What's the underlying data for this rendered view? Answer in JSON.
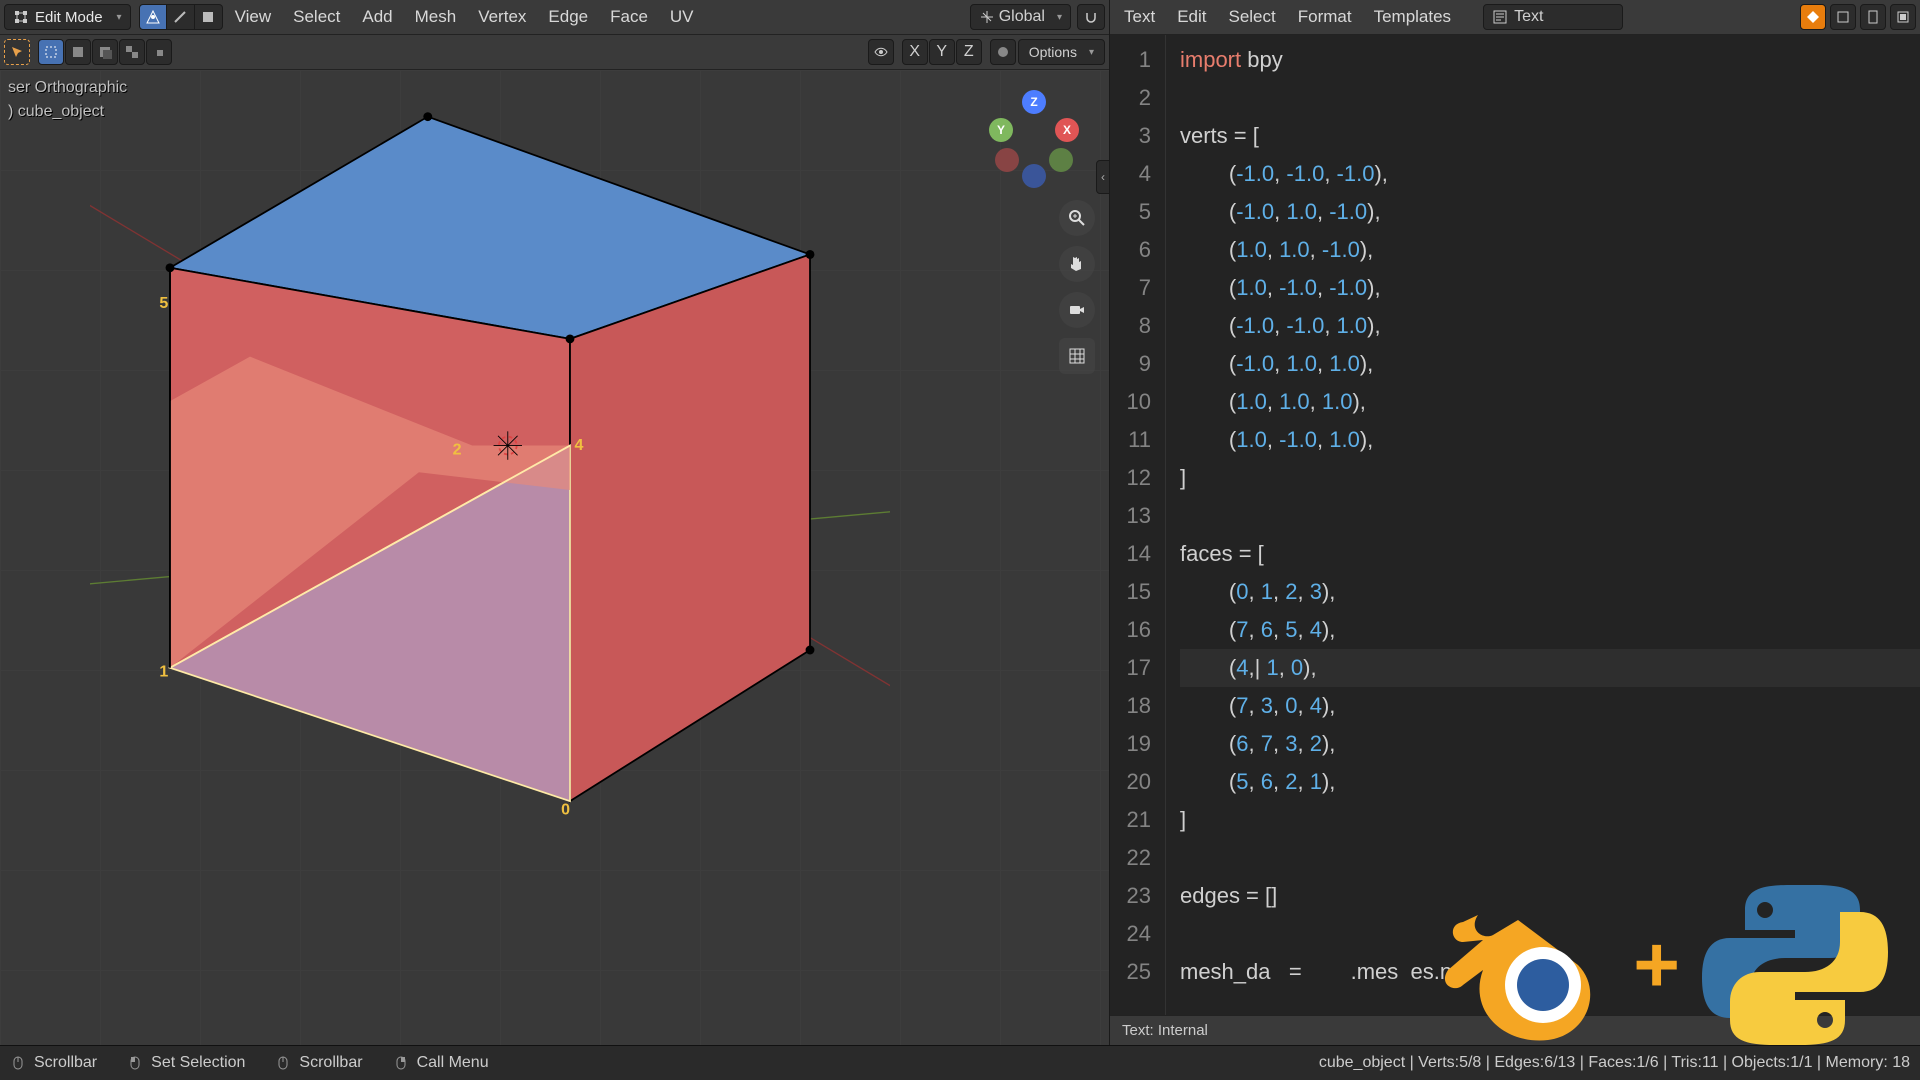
{
  "viewport": {
    "mode": "Edit Mode",
    "menus": [
      "View",
      "Select",
      "Add",
      "Mesh",
      "Vertex",
      "Edge",
      "Face",
      "UV"
    ],
    "orientation": "Global",
    "options_label": "Options",
    "axes": [
      "X",
      "Y",
      "Z"
    ],
    "overlay_view": "ser Orthographic",
    "overlay_object": ") cube_object",
    "gizmo": {
      "x": "X",
      "y": "Y",
      "z": "Z"
    },
    "vertex_labels": [
      "5",
      "2",
      "4",
      "1",
      "0"
    ]
  },
  "text_editor": {
    "menus": [
      "Text",
      "Edit",
      "Select",
      "Format",
      "Templates"
    ],
    "name": "Text",
    "footer": "Text: Internal",
    "code_lines": [
      {
        "n": 1,
        "tokens": [
          {
            "t": "import",
            "c": "kw"
          },
          {
            "t": " bpy",
            "c": "ident"
          }
        ]
      },
      {
        "n": 2,
        "tokens": []
      },
      {
        "n": 3,
        "tokens": [
          {
            "t": "verts = [",
            "c": "ident"
          }
        ]
      },
      {
        "n": 4,
        "tokens": [
          {
            "t": "        (",
            "c": "ident"
          },
          {
            "t": "-1.0",
            "c": "num"
          },
          {
            "t": ", ",
            "c": "ident"
          },
          {
            "t": "-1.0",
            "c": "num"
          },
          {
            "t": ", ",
            "c": "ident"
          },
          {
            "t": "-1.0",
            "c": "num"
          },
          {
            "t": "),",
            "c": "ident"
          }
        ]
      },
      {
        "n": 5,
        "tokens": [
          {
            "t": "        (",
            "c": "ident"
          },
          {
            "t": "-1.0",
            "c": "num"
          },
          {
            "t": ", ",
            "c": "ident"
          },
          {
            "t": "1.0",
            "c": "num"
          },
          {
            "t": ", ",
            "c": "ident"
          },
          {
            "t": "-1.0",
            "c": "num"
          },
          {
            "t": "),",
            "c": "ident"
          }
        ]
      },
      {
        "n": 6,
        "tokens": [
          {
            "t": "        (",
            "c": "ident"
          },
          {
            "t": "1.0",
            "c": "num"
          },
          {
            "t": ", ",
            "c": "ident"
          },
          {
            "t": "1.0",
            "c": "num"
          },
          {
            "t": ", ",
            "c": "ident"
          },
          {
            "t": "-1.0",
            "c": "num"
          },
          {
            "t": "),",
            "c": "ident"
          }
        ]
      },
      {
        "n": 7,
        "tokens": [
          {
            "t": "        (",
            "c": "ident"
          },
          {
            "t": "1.0",
            "c": "num"
          },
          {
            "t": ", ",
            "c": "ident"
          },
          {
            "t": "-1.0",
            "c": "num"
          },
          {
            "t": ", ",
            "c": "ident"
          },
          {
            "t": "-1.0",
            "c": "num"
          },
          {
            "t": "),",
            "c": "ident"
          }
        ]
      },
      {
        "n": 8,
        "tokens": [
          {
            "t": "        (",
            "c": "ident"
          },
          {
            "t": "-1.0",
            "c": "num"
          },
          {
            "t": ", ",
            "c": "ident"
          },
          {
            "t": "-1.0",
            "c": "num"
          },
          {
            "t": ", ",
            "c": "ident"
          },
          {
            "t": "1.0",
            "c": "num"
          },
          {
            "t": "),",
            "c": "ident"
          }
        ]
      },
      {
        "n": 9,
        "tokens": [
          {
            "t": "        (",
            "c": "ident"
          },
          {
            "t": "-1.0",
            "c": "num"
          },
          {
            "t": ", ",
            "c": "ident"
          },
          {
            "t": "1.0",
            "c": "num"
          },
          {
            "t": ", ",
            "c": "ident"
          },
          {
            "t": "1.0",
            "c": "num"
          },
          {
            "t": "),",
            "c": "ident"
          }
        ]
      },
      {
        "n": 10,
        "tokens": [
          {
            "t": "        (",
            "c": "ident"
          },
          {
            "t": "1.0",
            "c": "num"
          },
          {
            "t": ", ",
            "c": "ident"
          },
          {
            "t": "1.0",
            "c": "num"
          },
          {
            "t": ", ",
            "c": "ident"
          },
          {
            "t": "1.0",
            "c": "num"
          },
          {
            "t": "),",
            "c": "ident"
          }
        ]
      },
      {
        "n": 11,
        "tokens": [
          {
            "t": "        (",
            "c": "ident"
          },
          {
            "t": "1.0",
            "c": "num"
          },
          {
            "t": ", ",
            "c": "ident"
          },
          {
            "t": "-1.0",
            "c": "num"
          },
          {
            "t": ", ",
            "c": "ident"
          },
          {
            "t": "1.0",
            "c": "num"
          },
          {
            "t": "),",
            "c": "ident"
          }
        ]
      },
      {
        "n": 12,
        "tokens": [
          {
            "t": "]",
            "c": "ident"
          }
        ]
      },
      {
        "n": 13,
        "tokens": []
      },
      {
        "n": 14,
        "tokens": [
          {
            "t": "faces = [",
            "c": "ident"
          }
        ]
      },
      {
        "n": 15,
        "tokens": [
          {
            "t": "        (",
            "c": "ident"
          },
          {
            "t": "0",
            "c": "num"
          },
          {
            "t": ", ",
            "c": "ident"
          },
          {
            "t": "1",
            "c": "num"
          },
          {
            "t": ", ",
            "c": "ident"
          },
          {
            "t": "2",
            "c": "num"
          },
          {
            "t": ", ",
            "c": "ident"
          },
          {
            "t": "3",
            "c": "num"
          },
          {
            "t": "),",
            "c": "ident"
          }
        ]
      },
      {
        "n": 16,
        "tokens": [
          {
            "t": "        (",
            "c": "ident"
          },
          {
            "t": "7",
            "c": "num"
          },
          {
            "t": ", ",
            "c": "ident"
          },
          {
            "t": "6",
            "c": "num"
          },
          {
            "t": ", ",
            "c": "ident"
          },
          {
            "t": "5",
            "c": "num"
          },
          {
            "t": ", ",
            "c": "ident"
          },
          {
            "t": "4",
            "c": "num"
          },
          {
            "t": "),",
            "c": "ident"
          }
        ]
      },
      {
        "n": 17,
        "current": true,
        "tokens": [
          {
            "t": "        (",
            "c": "ident"
          },
          {
            "t": "4",
            "c": "num"
          },
          {
            "t": ",| ",
            "c": "ident"
          },
          {
            "t": "1",
            "c": "num"
          },
          {
            "t": ", ",
            "c": "ident"
          },
          {
            "t": "0",
            "c": "num"
          },
          {
            "t": "),",
            "c": "ident"
          }
        ]
      },
      {
        "n": 18,
        "tokens": [
          {
            "t": "        (",
            "c": "ident"
          },
          {
            "t": "7",
            "c": "num"
          },
          {
            "t": ", ",
            "c": "ident"
          },
          {
            "t": "3",
            "c": "num"
          },
          {
            "t": ", ",
            "c": "ident"
          },
          {
            "t": "0",
            "c": "num"
          },
          {
            "t": ", ",
            "c": "ident"
          },
          {
            "t": "4",
            "c": "num"
          },
          {
            "t": "),",
            "c": "ident"
          }
        ]
      },
      {
        "n": 19,
        "tokens": [
          {
            "t": "        (",
            "c": "ident"
          },
          {
            "t": "6",
            "c": "num"
          },
          {
            "t": ", ",
            "c": "ident"
          },
          {
            "t": "7",
            "c": "num"
          },
          {
            "t": ", ",
            "c": "ident"
          },
          {
            "t": "3",
            "c": "num"
          },
          {
            "t": ", ",
            "c": "ident"
          },
          {
            "t": "2",
            "c": "num"
          },
          {
            "t": "),",
            "c": "ident"
          }
        ]
      },
      {
        "n": 20,
        "tokens": [
          {
            "t": "        (",
            "c": "ident"
          },
          {
            "t": "5",
            "c": "num"
          },
          {
            "t": ", ",
            "c": "ident"
          },
          {
            "t": "6",
            "c": "num"
          },
          {
            "t": ", ",
            "c": "ident"
          },
          {
            "t": "2",
            "c": "num"
          },
          {
            "t": ", ",
            "c": "ident"
          },
          {
            "t": "1",
            "c": "num"
          },
          {
            "t": "),",
            "c": "ident"
          }
        ]
      },
      {
        "n": 21,
        "tokens": [
          {
            "t": "]",
            "c": "ident"
          }
        ]
      },
      {
        "n": 22,
        "tokens": []
      },
      {
        "n": 23,
        "tokens": [
          {
            "t": "edges = []",
            "c": "ident"
          }
        ]
      },
      {
        "n": 24,
        "tokens": []
      },
      {
        "n": 25,
        "tokens": [
          {
            "t": "mesh_da   =        .mes  es.ne    ube_dat",
            "c": "ident"
          }
        ]
      }
    ]
  },
  "status": {
    "scrollbar": "Scrollbar",
    "set_selection": "Set Selection",
    "scrollbar2": "Scrollbar",
    "call_menu": "Call Menu",
    "right": "cube_object | Verts:5/8 | Edges:6/13 | Faces:1/6 | Tris:11 | Objects:1/1 | Memory: 18"
  }
}
